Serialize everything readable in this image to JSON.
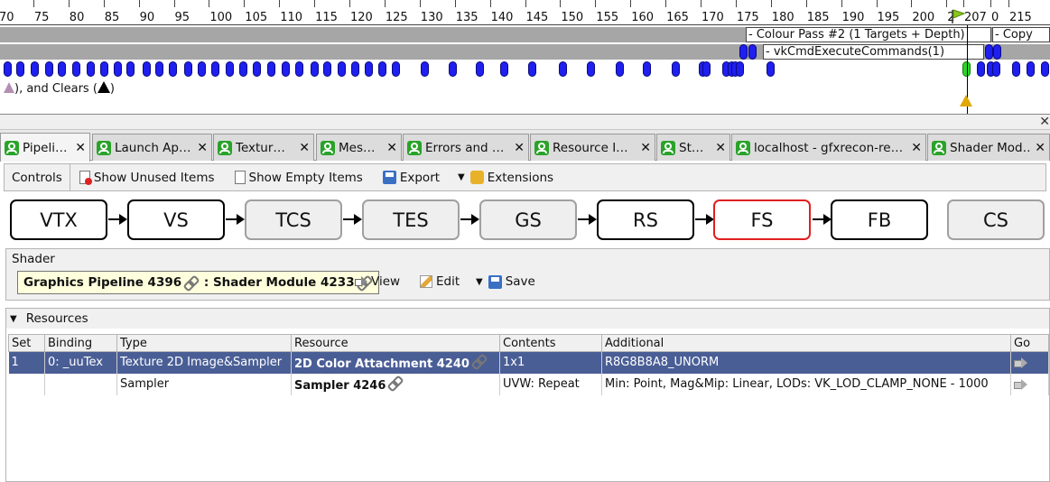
{
  "timeline": {
    "ruler_ticks": [
      "70",
      "75",
      "80",
      "85",
      "90",
      "95",
      "100",
      "105",
      "110",
      "115",
      "120",
      "125",
      "130",
      "135",
      "140",
      "145",
      "150",
      "155",
      "160",
      "165",
      "170",
      "175",
      "180",
      "185",
      "190",
      "195",
      "200",
      "2",
      "207",
      "0",
      "215"
    ],
    "passes": {
      "colour_pass": "- Colour Pass #2 (1 Targets + Depth)",
      "copy": "- Copy",
      "execute": "- vkCmdExecuteCommands(1)"
    },
    "legend_prefix": "",
    "legend_mid": "), and Clears (",
    "legend_suffix": ")"
  },
  "tabs": [
    {
      "label": "Pipeli…",
      "close": "✕"
    },
    {
      "label": "Launch Ap…",
      "close": "✕"
    },
    {
      "label": "Textur…",
      "close": "✕"
    },
    {
      "label": "Mes…",
      "close": "✕"
    },
    {
      "label": "Errors and …",
      "close": "✕"
    },
    {
      "label": "Resource I…",
      "close": "✕"
    },
    {
      "label": "St…",
      "close": "✕"
    },
    {
      "label": "localhost - gfxrecon-re…",
      "close": "✕"
    },
    {
      "label": "Shader Mod…",
      "close": "✕"
    }
  ],
  "toolbar": {
    "controls": "Controls",
    "show_unused": "Show Unused Items",
    "show_empty": "Show Empty Items",
    "export": "Export",
    "extensions": "Extensions"
  },
  "pipeline": {
    "stages": [
      "VTX",
      "VS",
      "TCS",
      "TES",
      "GS",
      "RS",
      "FS",
      "FB",
      "CS"
    ]
  },
  "shader": {
    "title": "Shader",
    "pipeline_name": "Graphics Pipeline 4396",
    "separator": " : ",
    "module_name": "Shader Module 4233",
    "view": "View",
    "edit": "Edit",
    "save": "Save"
  },
  "resources": {
    "title": "Resources",
    "columns": [
      "Set",
      "Binding",
      "Type",
      "Resource",
      "Contents",
      "Additional",
      "Go"
    ],
    "rows": [
      {
        "set": "1",
        "binding": "0: _uuTex",
        "type": "Texture 2D Image&Sampler",
        "resource": "2D Color Attachment 4240",
        "contents": "1x1",
        "additional": "R8G8B8A8_UNORM"
      },
      {
        "set": "",
        "binding": "",
        "type": "Sampler",
        "resource": "Sampler 4246",
        "contents": "UVW: Repeat",
        "additional": "Min: Point, Mag&Mip: Linear, LODs: VK_LOD_CLAMP_NONE - 1000"
      }
    ]
  },
  "colors": {
    "event_marker": "#1f1ff0",
    "selected_event": "#29d629",
    "row_selected": "#4a5e96",
    "stage_selected_border": "#e02020",
    "shader_field_bg": "#ffffdd"
  }
}
